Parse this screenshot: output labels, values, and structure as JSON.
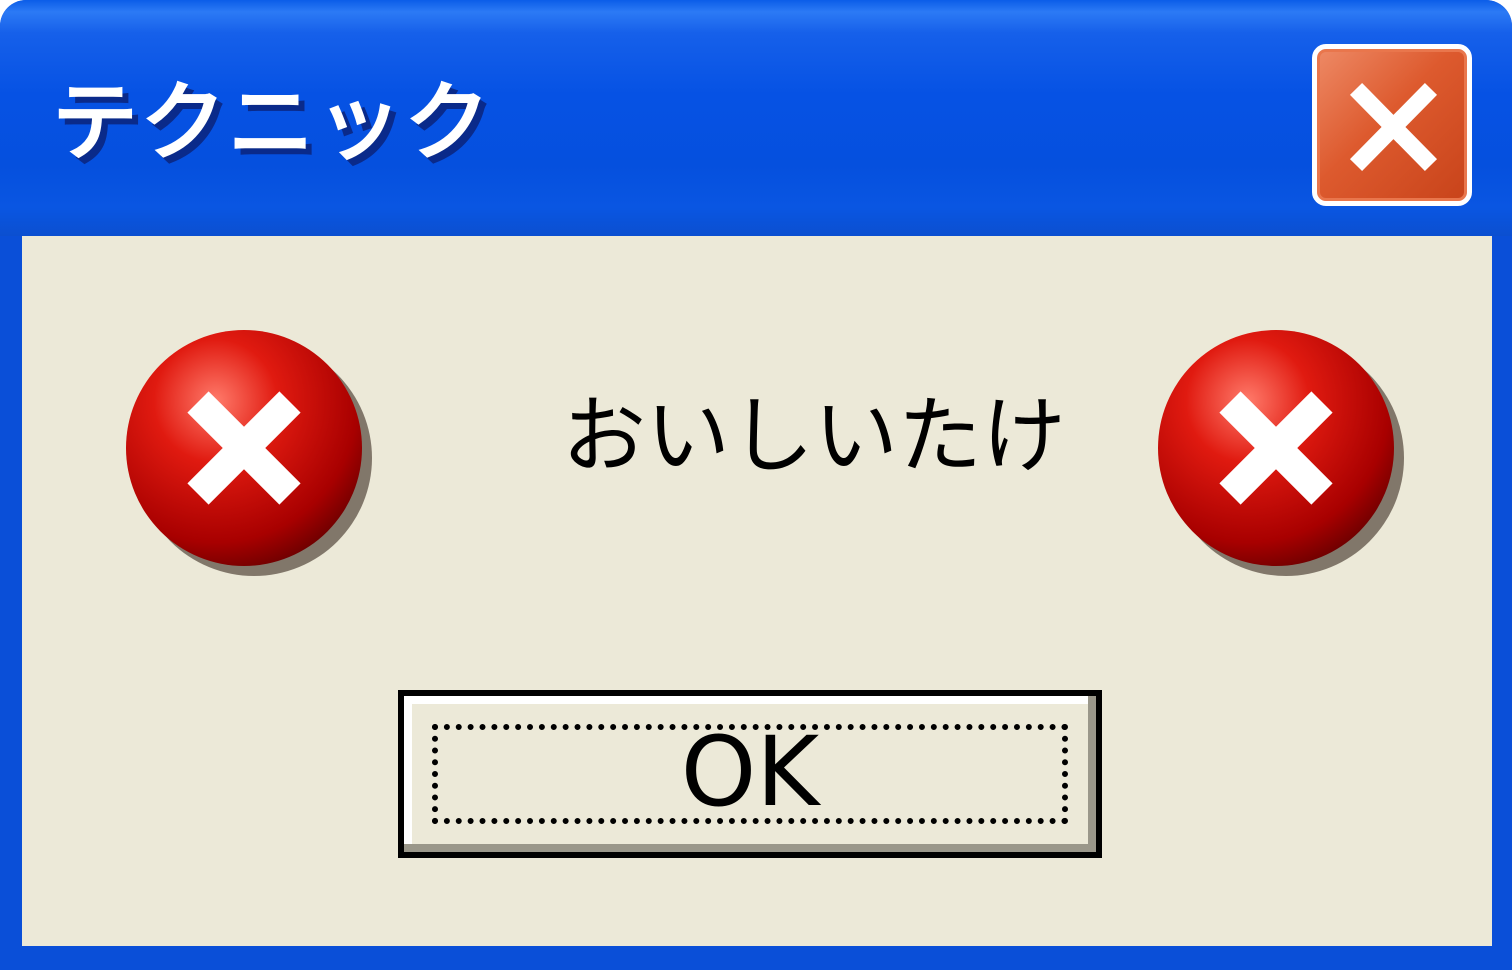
{
  "window": {
    "title": "テクニック"
  },
  "dialog": {
    "message": "おいしいたけ",
    "ok_label": "OK",
    "icons": [
      "error-icon",
      "error-icon"
    ]
  },
  "titlebar_controls": {
    "close_icon": "close-icon"
  },
  "colors": {
    "titlebar": "#0652e4",
    "client_bg": "#ece9d8",
    "close_button": "#dd5a2e",
    "error_red": "#d40000"
  }
}
